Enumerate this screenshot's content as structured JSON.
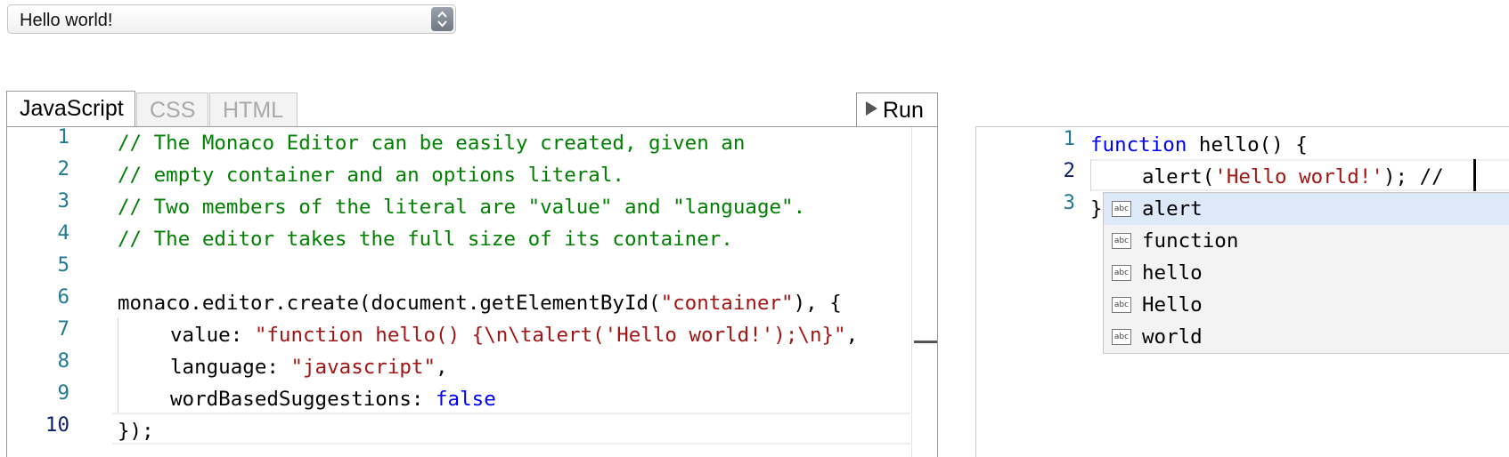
{
  "selector": {
    "value": "Hello world!"
  },
  "tabs": [
    {
      "label": "JavaScript",
      "active": true
    },
    {
      "label": "CSS",
      "active": false
    },
    {
      "label": "HTML",
      "active": false
    }
  ],
  "run_label": "Run",
  "left_editor": {
    "line_numbers": [
      "1",
      "2",
      "3",
      "4",
      "5",
      "6",
      "7",
      "8",
      "9",
      "10"
    ],
    "l1": "// The Monaco Editor can be easily created, given an",
    "l2": "// empty container and an options literal.",
    "l3": "// Two members of the literal are \"value\" and \"language\".",
    "l4": "// The editor takes the full size of its container.",
    "l6a": "monaco.editor.create(document.getElementById(",
    "l6b": "\"container\"",
    "l6c": "), {",
    "l7a": "value: ",
    "l7b": "\"function hello() {\\n\\talert('Hello world!');\\n}\"",
    "l7c": ",",
    "l8a": "language: ",
    "l8b": "\"javascript\"",
    "l8c": ",",
    "l9a": "wordBasedSuggestions: ",
    "l9b": "false",
    "l10": "});"
  },
  "right_editor": {
    "line_numbers": [
      "1",
      "2",
      "3"
    ],
    "r1a": "function",
    "r1b": " hello() {",
    "r2a": "alert(",
    "r2b": "'Hello world!'",
    "r2c": "); //",
    "r3": "}"
  },
  "suggestions": [
    {
      "icon": "abc",
      "label": "alert",
      "selected": true
    },
    {
      "icon": "abc",
      "label": "function",
      "selected": false
    },
    {
      "icon": "abc",
      "label": "hello",
      "selected": false
    },
    {
      "icon": "abc",
      "label": "Hello",
      "selected": false
    },
    {
      "icon": "abc",
      "label": "world",
      "selected": false
    }
  ],
  "colors": {
    "comment": "#008000",
    "string": "#a31515",
    "keyword": "#0000ff",
    "line_number": "#237893"
  }
}
